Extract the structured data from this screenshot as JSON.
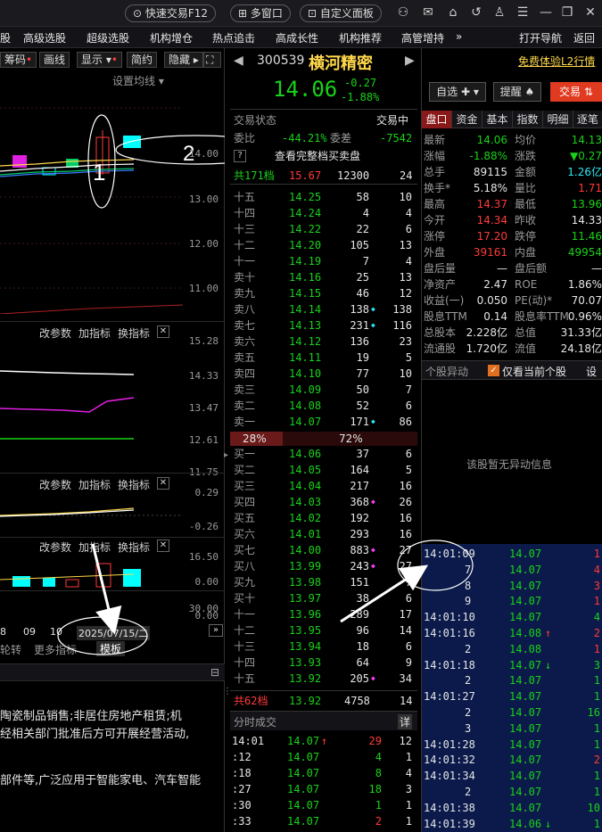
{
  "topbar": {
    "quick_trade": "快速交易F12",
    "multi_window": "多窗口",
    "custom_panel": "自定义面板"
  },
  "menu": {
    "items": [
      "股",
      "高级选股",
      "超级选股",
      "机构增仓",
      "热点追击",
      "高成长性",
      "机构推荐",
      "高管增持",
      "»"
    ],
    "open_nav": "打开导航",
    "back": "返回"
  },
  "left": {
    "tabs": [
      "筹码",
      "画线",
      "显示",
      "简约",
      "隐藏"
    ],
    "set_ma": "设置均线",
    "main_axis": [
      "14.00",
      "13.00",
      "12.00",
      "11.00"
    ],
    "annot1": "1",
    "annot2": "2",
    "sub1_toolbar": [
      "改参数",
      "加指标",
      "换指标"
    ],
    "sub1_axis": [
      "15.28",
      "14.33",
      "13.47",
      "12.61",
      "11.75"
    ],
    "sub2_toolbar": [
      "改参数",
      "加指标",
      "换指标"
    ],
    "sub2_axis": [
      "0.29",
      "-0.26"
    ],
    "sub3_toolbar": [
      "改参数",
      "加指标",
      "换指标"
    ],
    "sub3_axis": [
      "16.50",
      "0.00"
    ],
    "sub4_axis": [
      "30.00",
      "0.00"
    ],
    "date_axis": [
      "8",
      "09",
      "10"
    ],
    "date_label": "2025/07/15/二",
    "bottom_tabs": [
      "轮转",
      "更多指标",
      "模板"
    ],
    "company_text": [
      "陶瓷制品销售;非居住房地产租赁;机",
      "经相关部门批准后方可开展经营活动,",
      "",
      "部件等,广泛应用于智能家电、汽车智能"
    ]
  },
  "stock": {
    "code": "300539",
    "name": "横河精密",
    "price": "14.06",
    "change": "-0.27",
    "change_pct": "-1.88%",
    "free_l2": "免费体验L2行情",
    "watchlist": "自选",
    "remind": "提醒",
    "trade": "交易"
  },
  "orderbook": {
    "status_label": "交易状态",
    "status_value": "交易中",
    "weibi_label": "委比",
    "weibi_value": "-44.21%",
    "weicha_label": "委差",
    "weicha_value": "-7542",
    "view_full": "查看完整档买卖盘",
    "total_sell": {
      "label": "共171档",
      "price": "15.67",
      "vol": "12300",
      "cnt": "24"
    },
    "sells": [
      {
        "label": "十五",
        "price": "14.25",
        "vol": "58",
        "cnt": "10",
        "mark": ""
      },
      {
        "label": "十四",
        "price": "14.24",
        "vol": "4",
        "cnt": "4",
        "mark": ""
      },
      {
        "label": "十三",
        "price": "14.22",
        "vol": "22",
        "cnt": "6",
        "mark": ""
      },
      {
        "label": "十二",
        "price": "14.20",
        "vol": "105",
        "cnt": "13",
        "mark": ""
      },
      {
        "label": "十一",
        "price": "14.19",
        "vol": "7",
        "cnt": "4",
        "mark": ""
      },
      {
        "label": "卖十",
        "price": "14.16",
        "vol": "25",
        "cnt": "13",
        "mark": ""
      },
      {
        "label": "卖九",
        "price": "14.15",
        "vol": "46",
        "cnt": "12",
        "mark": ""
      },
      {
        "label": "卖八",
        "price": "14.14",
        "vol": "138",
        "cnt": "138",
        "mark": "cyan"
      },
      {
        "label": "卖七",
        "price": "14.13",
        "vol": "231",
        "cnt": "116",
        "mark": "cyan"
      },
      {
        "label": "卖六",
        "price": "14.12",
        "vol": "136",
        "cnt": "23",
        "mark": ""
      },
      {
        "label": "卖五",
        "price": "14.11",
        "vol": "19",
        "cnt": "5",
        "mark": ""
      },
      {
        "label": "卖四",
        "price": "14.10",
        "vol": "77",
        "cnt": "10",
        "mark": ""
      },
      {
        "label": "卖三",
        "price": "14.09",
        "vol": "50",
        "cnt": "7",
        "mark": ""
      },
      {
        "label": "卖二",
        "price": "14.08",
        "vol": "52",
        "cnt": "6",
        "mark": ""
      },
      {
        "label": "卖一",
        "price": "14.07",
        "vol": "171",
        "cnt": "86",
        "mark": "cyan"
      }
    ],
    "ratio_sell": "28%",
    "ratio_buy": "72%",
    "buys": [
      {
        "label": "买一",
        "price": "14.06",
        "vol": "37",
        "cnt": "6",
        "mark": ""
      },
      {
        "label": "买二",
        "price": "14.05",
        "vol": "164",
        "cnt": "5",
        "mark": ""
      },
      {
        "label": "买三",
        "price": "14.04",
        "vol": "217",
        "cnt": "16",
        "mark": ""
      },
      {
        "label": "买四",
        "price": "14.03",
        "vol": "368",
        "cnt": "26",
        "mark": "magenta"
      },
      {
        "label": "买五",
        "price": "14.02",
        "vol": "192",
        "cnt": "16",
        "mark": ""
      },
      {
        "label": "买六",
        "price": "14.01",
        "vol": "293",
        "cnt": "16",
        "mark": ""
      },
      {
        "label": "买七",
        "price": "14.00",
        "vol": "883",
        "cnt": "27",
        "mark": "magenta"
      },
      {
        "label": "买八",
        "price": "13.99",
        "vol": "243",
        "cnt": "27",
        "mark": "magenta"
      },
      {
        "label": "买九",
        "price": "13.98",
        "vol": "151",
        "cnt": "7",
        "mark": ""
      },
      {
        "label": "买十",
        "price": "13.97",
        "vol": "38",
        "cnt": "6",
        "mark": ""
      },
      {
        "label": "十一",
        "price": "13.96",
        "vol": "289",
        "cnt": "17",
        "mark": ""
      },
      {
        "label": "十二",
        "price": "13.95",
        "vol": "96",
        "cnt": "14",
        "mark": ""
      },
      {
        "label": "十三",
        "price": "13.94",
        "vol": "18",
        "cnt": "6",
        "mark": ""
      },
      {
        "label": "十四",
        "price": "13.93",
        "vol": "64",
        "cnt": "9",
        "mark": ""
      },
      {
        "label": "十五",
        "price": "13.92",
        "vol": "205",
        "cnt": "34",
        "mark": "magenta"
      }
    ],
    "total_buy": {
      "label": "共62档",
      "price": "13.92",
      "vol": "4758",
      "cnt": "14"
    },
    "fenshi_title": "分时成交",
    "fenshi_detail": "详",
    "fenshi": [
      {
        "time": "14:01",
        "price": "14.07",
        "arrow": "up",
        "vol": "29",
        "cnt": "12",
        "vol_color": "red"
      },
      {
        "time": ":12",
        "price": "14.07",
        "arrow": "",
        "vol": "4",
        "cnt": "1",
        "vol_color": "green"
      },
      {
        "time": ":18",
        "price": "14.07",
        "arrow": "",
        "vol": "8",
        "cnt": "4",
        "vol_color": "green"
      },
      {
        "time": ":27",
        "price": "14.07",
        "arrow": "",
        "vol": "18",
        "cnt": "3",
        "vol_color": "green"
      },
      {
        "time": ":30",
        "price": "14.07",
        "arrow": "",
        "vol": "1",
        "cnt": "1",
        "vol_color": "green"
      },
      {
        "time": ":33",
        "price": "14.07",
        "arrow": "",
        "vol": "2",
        "cnt": "1",
        "vol_color": "red"
      }
    ]
  },
  "quote": {
    "tabs": [
      "盘口",
      "资金",
      "基本",
      "指数",
      "明细",
      "逐笔"
    ],
    "rows": [
      {
        "l1": "最新",
        "v1": "14.06",
        "c1": "green",
        "l2": "均价",
        "v2": "14.13",
        "c2": "green"
      },
      {
        "l1": "涨幅",
        "v1": "-1.88%",
        "c1": "green",
        "l2": "涨跌",
        "v2": "▼0.27",
        "c2": "green"
      },
      {
        "l1": "总手",
        "v1": "89115",
        "c1": "white",
        "l2": "金额",
        "v2": "1.26亿",
        "c2": "cyan"
      },
      {
        "l1": "换手*",
        "v1": "5.18%",
        "c1": "white",
        "l2": "量比",
        "v2": "1.71",
        "c2": "red"
      },
      {
        "l1": "最高",
        "v1": "14.37",
        "c1": "red",
        "l2": "最低",
        "v2": "13.96",
        "c2": "green"
      },
      {
        "l1": "今开",
        "v1": "14.34",
        "c1": "red",
        "l2": "昨收",
        "v2": "14.33",
        "c2": "white"
      },
      {
        "l1": "涨停",
        "v1": "17.20",
        "c1": "red",
        "l2": "跌停",
        "v2": "11.46",
        "c2": "green"
      },
      {
        "l1": "外盘",
        "v1": "39161",
        "c1": "red",
        "l2": "内盘",
        "v2": "49954",
        "c2": "green"
      },
      {
        "l1": "盘后量",
        "v1": "—",
        "c1": "white",
        "l2": "盘后额",
        "v2": "—",
        "c2": "white"
      },
      {
        "l1": "净资产",
        "v1": "2.47",
        "c1": "white",
        "l2": "ROE",
        "v2": "1.86%",
        "c2": "white"
      },
      {
        "l1": "收益(一)",
        "v1": "0.050",
        "c1": "white",
        "l2": "PE(动)*",
        "v2": "70.07",
        "c2": "white"
      },
      {
        "l1": "股息TTM",
        "v1": "0.14",
        "c1": "white",
        "l2": "股息率TTM",
        "v2": "0.96%",
        "c2": "white"
      },
      {
        "l1": "总股本",
        "v1": "2.228亿",
        "c1": "white",
        "l2": "总值",
        "v2": "31.33亿",
        "c2": "white"
      },
      {
        "l1": "流通股",
        "v1": "1.720亿",
        "c1": "white",
        "l2": "流值",
        "v2": "24.18亿",
        "c2": "white"
      }
    ],
    "abnormal_title": "个股异动",
    "only_current": "仅看当前个股",
    "settings": "设",
    "no_abnormal": "该股暂无异动信息"
  },
  "ticks": [
    {
      "time": "14:01:09",
      "price": "14.07",
      "arrow": "",
      "vol": "1",
      "vc": "red"
    },
    {
      "time": "7",
      "price": "14.07",
      "arrow": "",
      "vol": "4",
      "vc": "red"
    },
    {
      "time": "8",
      "price": "14.07",
      "arrow": "",
      "vol": "3",
      "vc": "red"
    },
    {
      "time": "9",
      "price": "14.07",
      "arrow": "",
      "vol": "1",
      "vc": "red"
    },
    {
      "time": "14:01:10",
      "price": "14.07",
      "arrow": "",
      "vol": "4",
      "vc": "green"
    },
    {
      "time": "14:01:16",
      "price": "14.08",
      "arrow": "up",
      "vol": "2",
      "vc": "red"
    },
    {
      "time": "2",
      "price": "14.08",
      "arrow": "",
      "vol": "1",
      "vc": "red"
    },
    {
      "time": "14:01:18",
      "price": "14.07",
      "arrow": "down",
      "vol": "3",
      "vc": "green"
    },
    {
      "time": "2",
      "price": "14.07",
      "arrow": "",
      "vol": "1",
      "vc": "green"
    },
    {
      "time": "14:01:27",
      "price": "14.07",
      "arrow": "",
      "vol": "1",
      "vc": "green"
    },
    {
      "time": "2",
      "price": "14.07",
      "arrow": "",
      "vol": "16",
      "vc": "green"
    },
    {
      "time": "3",
      "price": "14.07",
      "arrow": "",
      "vol": "1",
      "vc": "green"
    },
    {
      "time": "14:01:28",
      "price": "14.07",
      "arrow": "",
      "vol": "1",
      "vc": "green"
    },
    {
      "time": "14:01:32",
      "price": "14.07",
      "arrow": "",
      "vol": "2",
      "vc": "red"
    },
    {
      "time": "14:01:34",
      "price": "14.07",
      "arrow": "",
      "vol": "1",
      "vc": "green"
    },
    {
      "time": "2",
      "price": "14.07",
      "arrow": "",
      "vol": "1",
      "vc": "green"
    },
    {
      "time": "14:01:38",
      "price": "14.07",
      "arrow": "",
      "vol": "10",
      "vc": "green"
    },
    {
      "time": "14:01:39",
      "price": "14.06",
      "arrow": "down",
      "vol": "1",
      "vc": "green"
    }
  ],
  "colors": {
    "up": "#ff3a3a",
    "down": "#19d219",
    "highlight_blue": "#0b1a4a",
    "trade_button": "#e03a20"
  }
}
